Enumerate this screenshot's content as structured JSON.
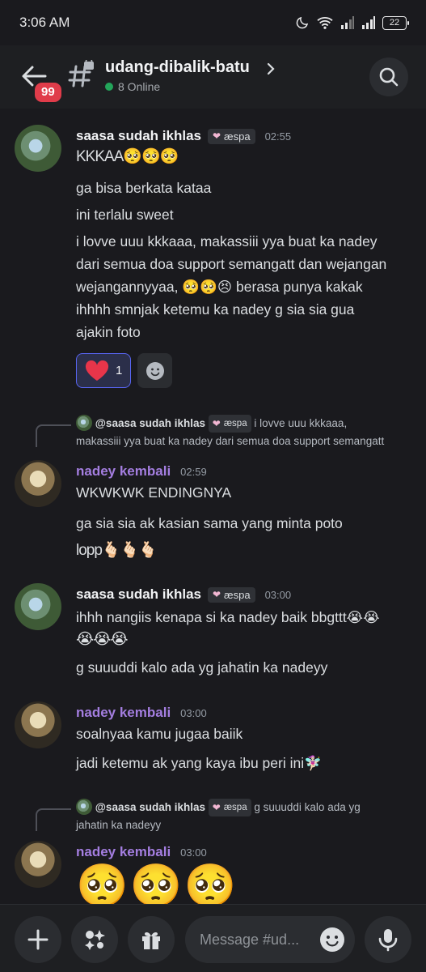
{
  "status_bar": {
    "time": "3:06 AM",
    "battery": "22"
  },
  "header": {
    "unread_badge": "99",
    "channel_name": "udang-dibalik-batu",
    "online": "8 Online"
  },
  "messages": [
    {
      "username": "saasa sudah ikhlas",
      "role": "æspa",
      "time": "02:55",
      "lines": [
        "KKKAA🥺🥺🥺",
        "ga bisa berkata kataa",
        "ini terlalu sweet",
        "i lovve uuu kkkaaa, makassiii yya buat ka nadey",
        "dari semua doa support semangatt dan wejangan",
        "wejangannyyaa, 🥺🥺😣 berasa punya kakak",
        "ihhhh smnjak ketemu ka nadey g sia sia gua",
        "ajakin foto"
      ],
      "reaction": {
        "emoji": "❤",
        "count": "1"
      }
    },
    {
      "reply": {
        "username": "@saasa sudah ikhlas",
        "role": "æspa",
        "text_1": "i lovve uuu kkkaaa,",
        "text_2": "makassiii yya buat ka nadey dari semua doa support semangatt"
      },
      "username": "nadey kembali",
      "time": "02:59",
      "lines": [
        "WKWKWK ENDINGNYA",
        "ga sia sia ak kasian sama yang minta poto",
        "lopp🫰🏻🫰🏻🫰🏻"
      ]
    },
    {
      "username": "saasa sudah ikhlas",
      "role": "æspa",
      "time": "03:00",
      "lines": [
        "ihhh nangiis kenapa si ka nadey baik bbgttt😭😭",
        "😭😭😭",
        "g suuuddi kalo ada yg jahatin ka nadeyy"
      ]
    },
    {
      "username": "nadey kembali",
      "time": "03:00",
      "lines": [
        "soalnyaa kamu jugaa baiik",
        "jadi ketemu ak yang kaya ibu peri ini🧚🏻‍♀️"
      ]
    },
    {
      "reply": {
        "username": "@saasa sudah ikhlas",
        "role": "æspa",
        "text_1": "g suuuddi kalo ada yg",
        "text_2": "jahatin ka nadeyy"
      },
      "username": "nadey kembali",
      "time": "03:00",
      "lines": [
        "🥺🥺🥺"
      ]
    }
  ],
  "composer": {
    "placeholder": "Message #ud..."
  },
  "colors": {
    "accent": "#5865f2",
    "online": "#23a55a",
    "badge": "#e03c4a",
    "nadey_name": "#a47ee0"
  }
}
